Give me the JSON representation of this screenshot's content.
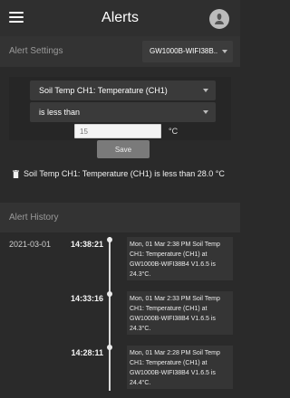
{
  "header": {
    "title": "Alerts"
  },
  "settings": {
    "label": "Alert Settings",
    "device_value": "GW1000B-WIFI38B..",
    "sensor_value": "Soil Temp CH1: Temperature (CH1)",
    "condition_value": "is less than",
    "threshold_placeholder": "15",
    "unit": "°C",
    "save_label": "Save",
    "existing_alert": "Soil Temp CH1: Temperature (CH1) is less than 28.0 °C"
  },
  "history": {
    "label": "Alert History",
    "date": "2021-03-01",
    "entries": [
      {
        "time": "14:38:21",
        "message": "Mon, 01 Mar 2:38 PM Soil Temp CH1: Temperature (CH1) at GW1000B-WIFI38B4 V1.6.5 is 24.3°C."
      },
      {
        "time": "14:33:16",
        "message": "Mon, 01 Mar 2:33 PM Soil Temp CH1: Temperature (CH1) at GW1000B-WIFI38B4 V1.6.5 is 24.3°C."
      },
      {
        "time": "14:28:11",
        "message": "Mon, 01 Mar 2:28 PM Soil Temp CH1: Temperature (CH1) at GW1000B-WIFI38B4 V1.6.5 is 24.4°C."
      }
    ]
  },
  "icons": {
    "menu": "hamburger-menu-icon",
    "user": "user-avatar-icon",
    "delete": "trash-icon",
    "dropdown": "chevron-down-icon"
  },
  "colors": {
    "background": "#2a2a2a",
    "topbar": "#2f2f2f",
    "section": "#333333",
    "save_button": "#7a7a7a",
    "timeline": "#d9d9d9"
  }
}
